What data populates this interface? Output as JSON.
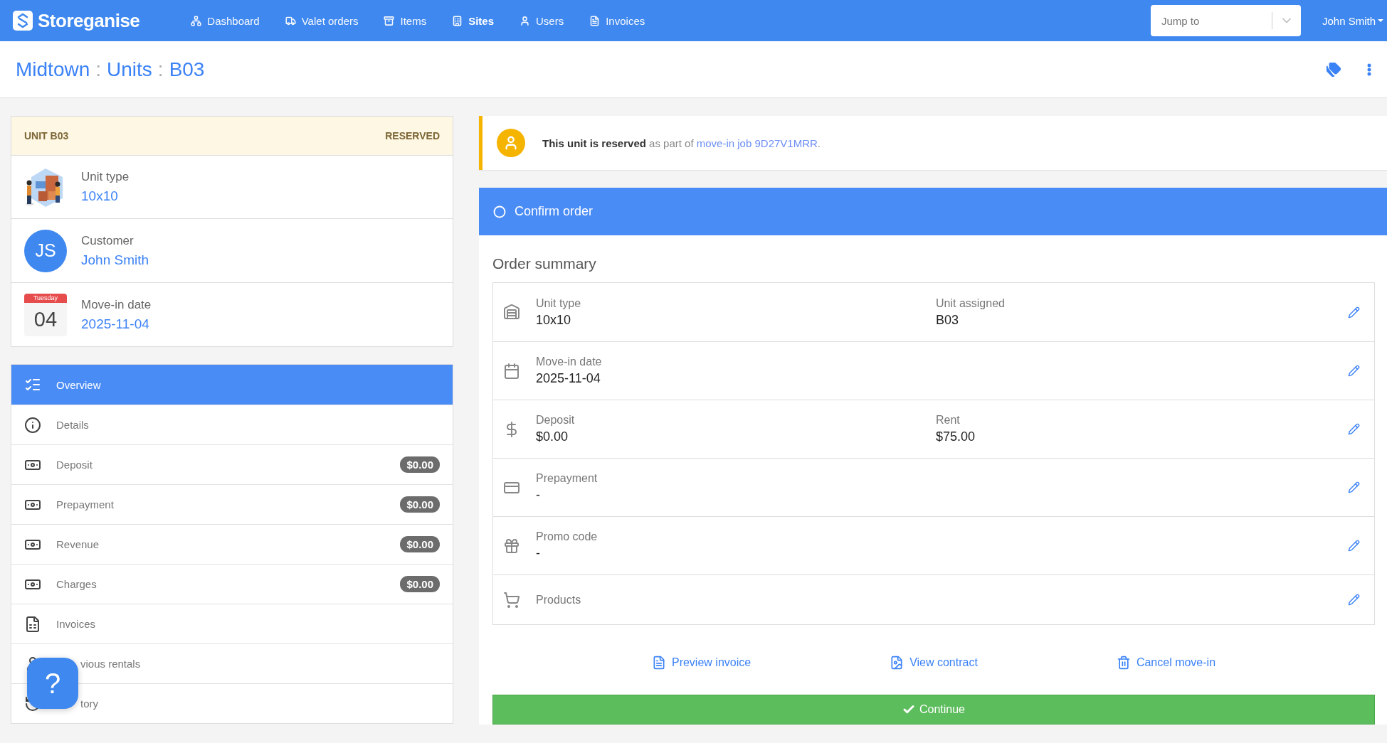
{
  "nav": {
    "logo": "Storeganise",
    "items": [
      {
        "label": "Dashboard",
        "selected": false
      },
      {
        "label": "Valet orders",
        "selected": false
      },
      {
        "label": "Items",
        "selected": false
      },
      {
        "label": "Sites",
        "selected": true
      },
      {
        "label": "Users",
        "selected": false
      },
      {
        "label": "Invoices",
        "selected": false
      }
    ],
    "jump_placeholder": "Jump to",
    "user": "John Smith"
  },
  "breadcrumb": [
    {
      "kind": "link",
      "text": "Midtown"
    },
    {
      "kind": "separator",
      "text": ":"
    },
    {
      "kind": "link",
      "text": "Units"
    },
    {
      "kind": "separator",
      "text": ":"
    },
    {
      "kind": "link",
      "text": "B03"
    }
  ],
  "unit_card": {
    "title": "UNIT B03",
    "status": "RESERVED",
    "rows": [
      {
        "kind": "picture",
        "label": "Unit type",
        "value": "10x10"
      },
      {
        "kind": "avatar",
        "initials": "JS",
        "label": "Customer",
        "value": "John Smith"
      },
      {
        "kind": "date",
        "weekday": "Tuesday",
        "day": "04",
        "label": "Move-in date",
        "value": "2025-11-04"
      }
    ]
  },
  "menu": [
    {
      "label": "Overview",
      "selected": true
    },
    {
      "label": "Details",
      "selected": false
    },
    {
      "label": "Deposit",
      "selected": false,
      "badge": "$0.00"
    },
    {
      "label": "Prepayment",
      "selected": false,
      "badge": "$0.00"
    },
    {
      "label": "Revenue",
      "selected": false,
      "badge": "$0.00"
    },
    {
      "label": "Charges",
      "selected": false,
      "badge": "$0.00"
    },
    {
      "label": "Invoices",
      "selected": false
    },
    {
      "label": "vious rentals",
      "selected": false,
      "clipped": true
    },
    {
      "label": "tory",
      "selected": false,
      "clipped": true
    }
  ],
  "help": {
    "label": "?"
  },
  "alert": {
    "text": "**This unit is reserved** as part of",
    "link": "move-in job 9D27V1MRR",
    "end": "."
  },
  "step": {
    "title": "Confirm order",
    "completed": false
  },
  "order_summary": {
    "title": "Order summary",
    "rows": [
      {
        "label": "Unit type",
        "value": "10x10",
        "label_2": "Unit assigned",
        "value_2": "B03"
      },
      {
        "label": "Move-in date",
        "value": "2025-11-04"
      },
      {
        "label": "Deposit",
        "value": "$0.00",
        "label_2": "Rent",
        "value_2": "$75.00"
      },
      {
        "label": "Prepayment",
        "value": "-"
      },
      {
        "label": "Promo code",
        "value": "-"
      },
      {
        "label": "Products"
      }
    ]
  },
  "actions": [
    "Preview invoice",
    "View contract",
    "Cancel move-in"
  ],
  "continue_button": "Continue"
}
